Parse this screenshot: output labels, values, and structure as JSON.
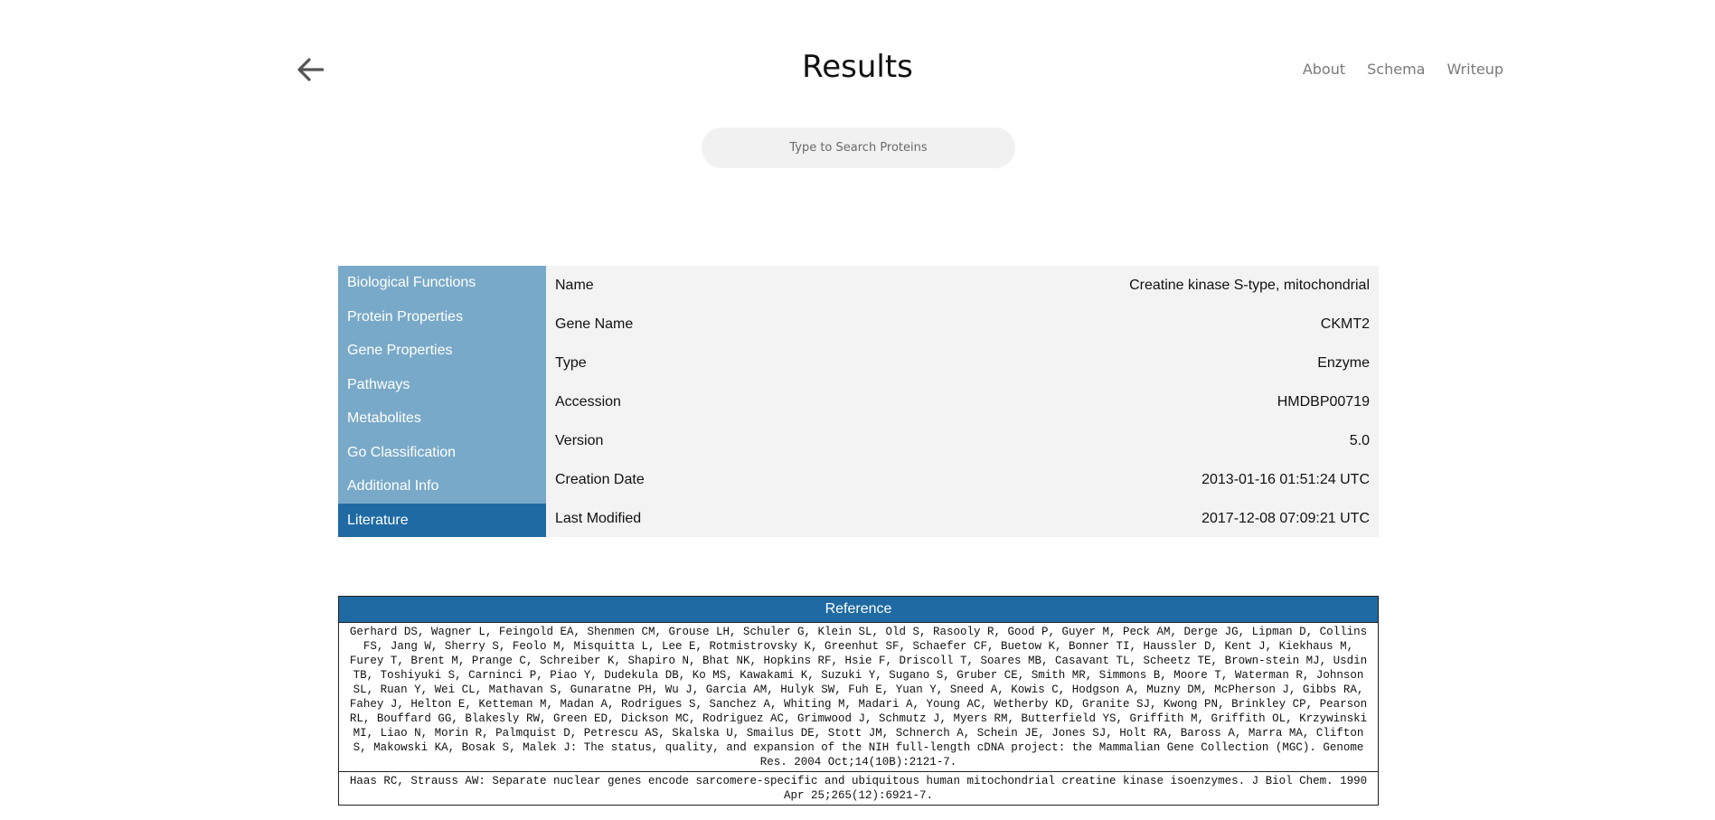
{
  "header": {
    "title": "Results",
    "nav": [
      "About",
      "Schema",
      "Writeup"
    ]
  },
  "search": {
    "placeholder": "Type to Search Proteins",
    "value": ""
  },
  "sidebar": {
    "items": [
      {
        "label": "Biological Functions",
        "active": false
      },
      {
        "label": "Protein Properties",
        "active": false
      },
      {
        "label": "Gene Properties",
        "active": false
      },
      {
        "label": "Pathways",
        "active": false
      },
      {
        "label": "Metabolites",
        "active": false
      },
      {
        "label": "Go Classification",
        "active": false
      },
      {
        "label": "Additional Info",
        "active": false
      },
      {
        "label": "Literature",
        "active": true
      }
    ]
  },
  "properties": [
    {
      "label": "Name",
      "value": "Creatine kinase S-type, mitochondrial"
    },
    {
      "label": "Gene Name",
      "value": "CKMT2"
    },
    {
      "label": "Type",
      "value": "Enzyme"
    },
    {
      "label": "Accession",
      "value": "HMDBP00719"
    },
    {
      "label": "Version",
      "value": "5.0"
    },
    {
      "label": "Creation Date",
      "value": "2013-01-16 01:51:24 UTC"
    },
    {
      "label": "Last Modified",
      "value": "2017-12-08 07:09:21 UTC"
    }
  ],
  "references": {
    "header": "Reference",
    "rows": [
      "Gerhard DS, Wagner L, Feingold EA, Shenmen CM, Grouse LH, Schuler G, Klein SL, Old S, Rasooly R, Good P, Guyer M, Peck AM, Derge JG, Lipman D, Collins FS, Jang W, Sherry S, Feolo M, Misquitta L, Lee E, Rotmistrovsky K, Greenhut SF, Schaefer CF, Buetow K, Bonner TI, Haussler D, Kent J, Kiekhaus M, Furey T, Brent M, Prange C, Schreiber K, Shapiro N, Bhat NK, Hopkins RF, Hsie F, Driscoll T, Soares MB, Casavant TL, Scheetz TE, Brown-stein MJ, Usdin TB, Toshiyuki S, Carninci P, Piao Y, Dudekula DB, Ko MS, Kawakami K, Suzuki Y, Sugano S, Gruber CE, Smith MR, Simmons B, Moore T, Waterman R, Johnson SL, Ruan Y, Wei CL, Mathavan S, Gunaratne PH, Wu J, Garcia AM, Hulyk SW, Fuh E, Yuan Y, Sneed A, Kowis C, Hodgson A, Muzny DM, McPherson J, Gibbs RA, Fahey J, Helton E, Ketteman M, Madan A, Rodrigues S, Sanchez A, Whiting M, Madari A, Young AC, Wetherby KD, Granite SJ, Kwong PN, Brinkley CP, Pearson RL, Bouffard GG, Blakesly RW, Green ED, Dickson MC, Rodriguez AC, Grimwood J, Schmutz J, Myers RM, Butterfield YS, Griffith M, Griffith OL, Krzywinski MI, Liao N, Morin R, Palmquist D, Petrescu AS, Skalska U, Smailus DE, Stott JM, Schnerch A, Schein JE, Jones SJ, Holt RA, Baross A, Marra MA, Clifton S, Makowski KA, Bosak S, Malek J: The status, quality, and expansion of the NIH full-length cDNA project: the Mammalian Gene Collection (MGC). Genome Res. 2004 Oct;14(10B):2121-7.",
      "Haas RC, Strauss AW: Separate nuclear genes encode sarcomere-specific and ubiquitous human mitochondrial creatine kinase isoenzymes. J Biol Chem. 1990 Apr 25;265(12):6921-7."
    ]
  }
}
